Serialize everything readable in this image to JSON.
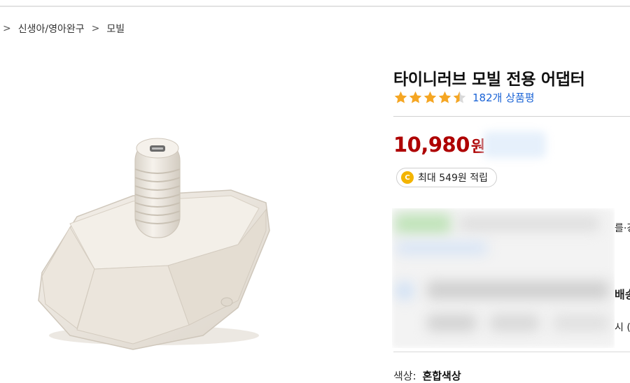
{
  "breadcrumb": {
    "separator": ">",
    "items": [
      "신생아/영아완구",
      "모빌"
    ]
  },
  "product": {
    "title": "타이니러브 모빌 전용 어댑터",
    "rating": 4.5,
    "rating_max": 5,
    "review_count": "182개 상품평",
    "price_amount": "10,980",
    "price_unit": "원",
    "reward_icon_letter": "C",
    "reward_text": "최대 549원 적립",
    "option_key": "색상:",
    "option_value": "혼합색상"
  },
  "right_fragments": {
    "line1": "를·강",
    "line2": "배송",
    "line3": "시 ("
  },
  "colors": {
    "price": "#ae0000",
    "star": "#f5a623",
    "link": "#1a63d6",
    "coin": "#f3b400"
  }
}
